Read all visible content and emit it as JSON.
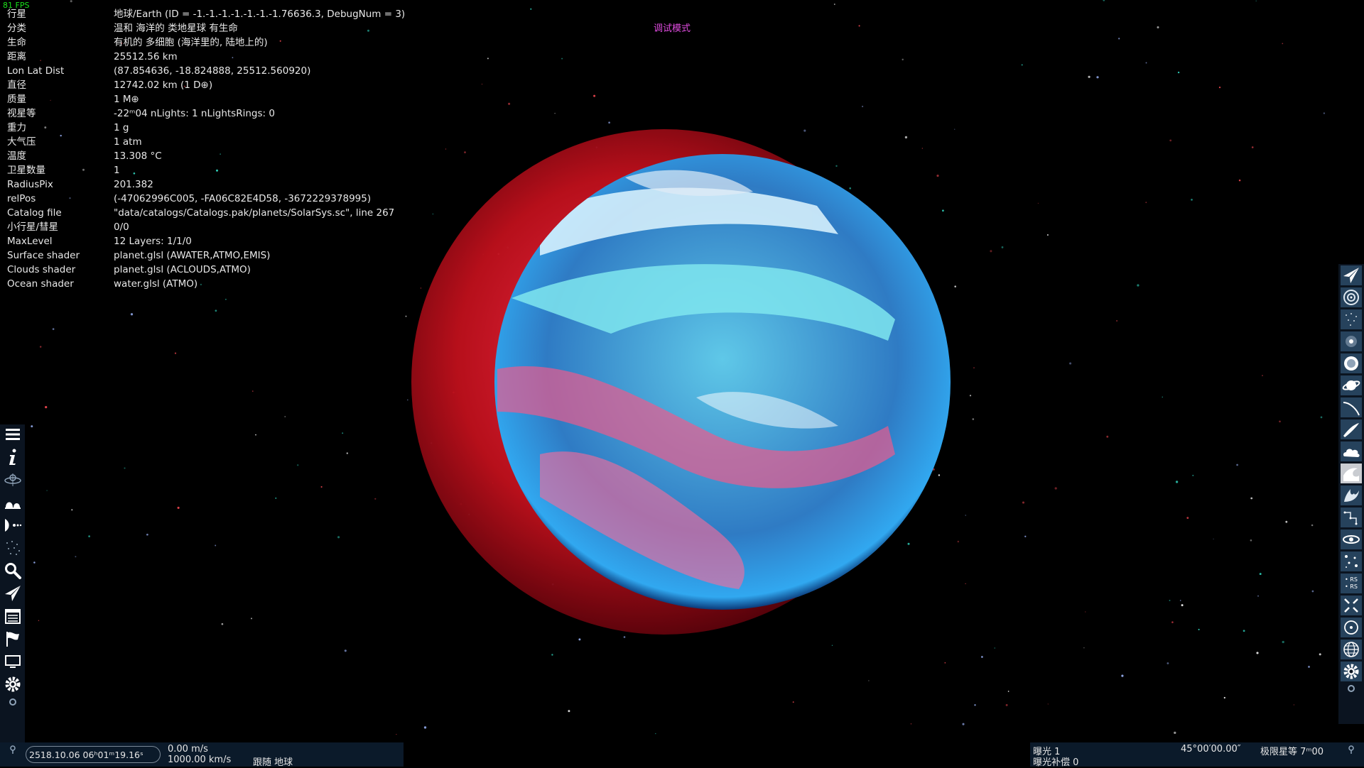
{
  "fps": "81 FPS",
  "debug_mode": "调试模式",
  "info_rows": [
    {
      "label": "行星",
      "value": "地球/Earth  (ID = -1.-1.-1.-1.-1.-1.-1.76636.3, DebugNum = 3)"
    },
    {
      "label": "分类",
      "value": "温和 海洋的 类地星球 有生命"
    },
    {
      "label": "生命",
      "value": "有机的 多细胞 (海洋里的, 陆地上的)"
    },
    {
      "label": "距离",
      "value": "25512.56 km"
    },
    {
      "label": "Lon Lat Dist",
      "value": "(87.854636, -18.824888, 25512.560920)"
    },
    {
      "label": "直径",
      "value": "12742.02 km (1 D⊕)"
    },
    {
      "label": "质量",
      "value": "1 M⊕"
    },
    {
      "label": "视星等",
      "value": "-22ᵐ04   nLights: 1   nLightsRings: 0"
    },
    {
      "label": "重力",
      "value": "1 g"
    },
    {
      "label": "大气压",
      "value": "1 atm"
    },
    {
      "label": "温度",
      "value": "13.308 °C"
    },
    {
      "label": "卫星数量",
      "value": "1"
    },
    {
      "label": "RadiusPix",
      "value": "201.382"
    },
    {
      "label": "relPos",
      "value": "(-47062996C005, -FA06C82E4D58, -3672229378995)"
    },
    {
      "label": "Catalog file",
      "value": "\"data/catalogs/Catalogs.pak/planets/SolarSys.sc\", line 267"
    },
    {
      "label": "小行星/彗星",
      "value": "0/0"
    },
    {
      "label": "MaxLevel",
      "value": "12   Layers: 1/1/0"
    },
    {
      "label": "Surface shader",
      "value": "planet.glsl (AWATER,ATMO,EMIS)"
    },
    {
      "label": "Clouds shader",
      "value": "planet.glsl (ACLOUDS,ATMO)"
    },
    {
      "label": "Ocean shader",
      "value": "water.glsl (ATMO)"
    }
  ],
  "left_toolbar_icons": [
    "menu-icon",
    "info-icon",
    "planetarium-icon",
    "places-icon",
    "star-system-icon",
    "star-field-icon",
    "search-icon",
    "ship-icon",
    "calendar-icon",
    "flag-icon",
    "display-icon",
    "settings-icon"
  ],
  "right_toolbar_icons": [
    "spacecraft-toggle-icon",
    "galaxy-toggle-icon",
    "star-cluster-toggle-icon",
    "nebula-toggle-icon",
    "star-toggle-icon",
    "planet-toggle-icon",
    "asteroid-toggle-icon",
    "comet-toggle-icon",
    "clouds-toggle-icon",
    "water-toggle-icon",
    "aurora-toggle-icon",
    "constellation-toggle-icon",
    "orbit-toggle-icon",
    "particles-toggle-icon",
    "rs-toggle-icon",
    "zoom-fit-icon",
    "target-icon",
    "grid-globe-icon",
    "settings-icon"
  ],
  "rs_labels": [
    "• RS",
    "• RS"
  ],
  "status": {
    "datetime": "2518.10.06 06ʰ01ᵐ19.16ˢ",
    "speed": "0.00 m/s",
    "speed_limit": "1000.00 km/s",
    "follow": "跟随 地球",
    "exposure": "曝光 1",
    "exposure_comp": "曝光补偿 0",
    "fov": "45°00′00.00″",
    "limit_mag": "极限星等  7ᵐ00"
  },
  "colors": {
    "background": "#000000",
    "panel": "#0b1420",
    "fps": "#16e01a",
    "debug": "#e04ce0",
    "anaglyph_red": "#c0101c",
    "anaglyph_cyan": "#1f8fd6"
  }
}
